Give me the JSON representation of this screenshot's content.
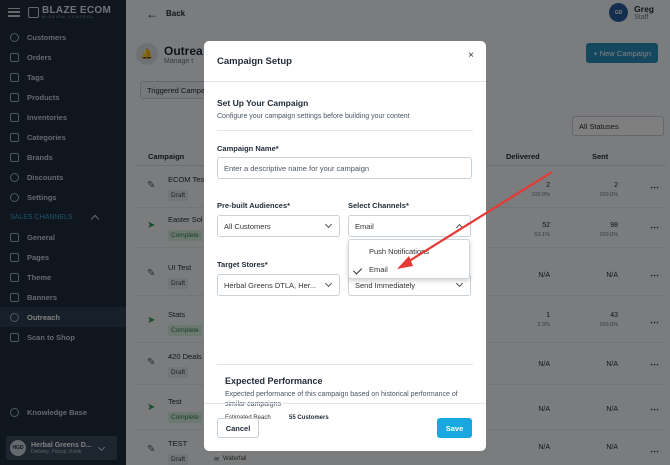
{
  "brand": {
    "name": "BLAZE ECOM",
    "tagline": "MISSION CONTROL"
  },
  "sidebar": {
    "items": [
      {
        "label": "Customers",
        "icon": "users-icon"
      },
      {
        "label": "Orders",
        "icon": "cart-icon"
      },
      {
        "label": "Tags",
        "icon": "tag-icon"
      },
      {
        "label": "Products",
        "icon": "box-icon"
      },
      {
        "label": "Inventories",
        "icon": "clipboard-icon"
      },
      {
        "label": "Categories",
        "icon": "grid-icon"
      },
      {
        "label": "Brands",
        "icon": "book-icon"
      },
      {
        "label": "Discounts",
        "icon": "percent-icon"
      },
      {
        "label": "Settings",
        "icon": "gear-icon"
      }
    ],
    "section_label": "SALES CHANNELS",
    "channel_items": [
      {
        "label": "General",
        "icon": "home-icon"
      },
      {
        "label": "Pages",
        "icon": "pages-icon"
      },
      {
        "label": "Theme",
        "icon": "palette-icon"
      },
      {
        "label": "Banners",
        "icon": "banner-icon"
      },
      {
        "label": "Outreach",
        "icon": "bell-icon",
        "active": true
      },
      {
        "label": "Scan to Shop",
        "icon": "qr-icon"
      }
    ],
    "knowledge_base": "Knowledge Base",
    "store": {
      "initials": "HGD",
      "name": "Herbal Greens D...",
      "sub": "Delivery, Pickup, Kiosk"
    }
  },
  "topbar": {
    "back_label": "Back",
    "user_initials": "GD",
    "user_name": "Greg",
    "user_role": "Staff"
  },
  "page": {
    "title": "Outrea",
    "subtitle": "Manage t",
    "new_button": "+ New Campaign",
    "filter_tab": "Triggered Campa",
    "status_filter": "All Statuses"
  },
  "table": {
    "headers": {
      "campaign": "Campaign",
      "delivered": "Delivered",
      "sent": "Sent"
    },
    "rows": [
      {
        "name": "ECOM Tes",
        "status": "Draft",
        "type": "draft",
        "delivered": "2",
        "delivered_pct": "100.0%",
        "sent": "2",
        "sent_pct": "100.0%"
      },
      {
        "name": "Easter Sol",
        "status": "Complete",
        "type": "complete",
        "delivered": "52",
        "delivered_pct": "53.1%",
        "sent": "98",
        "sent_pct": "100.0%"
      },
      {
        "name": "UI Test",
        "status": "Draft",
        "type": "draft",
        "delivered": "N/A",
        "delivered_pct": "",
        "sent": "N/A",
        "sent_pct": ""
      },
      {
        "name": "Stats",
        "status": "Complete",
        "type": "complete",
        "delivered": "1",
        "delivered_pct": "2.3%",
        "sent": "43",
        "sent_pct": "100.0%"
      },
      {
        "name": "420 Deals",
        "status": "Draft",
        "type": "draft",
        "delivered": "N/A",
        "delivered_pct": "",
        "sent": "N/A",
        "sent_pct": ""
      },
      {
        "name": "Test",
        "status": "Complete",
        "type": "complete",
        "delivered": "N/A",
        "delivered_pct": "",
        "sent": "N/A",
        "sent_pct": ""
      },
      {
        "name": "TEST",
        "status": "Draft",
        "type": "draft",
        "delivered": "N/A",
        "delivered_pct": "",
        "sent": "N/A",
        "sent_pct": "",
        "extra": "Waterfall"
      }
    ]
  },
  "modal": {
    "title": "Campaign Setup",
    "close": "×",
    "section_title": "Set Up Your Campaign",
    "section_sub": "Configure your campaign settings before building your content",
    "campaign_name_label": "Campaign Name*",
    "campaign_name_placeholder": "Enter a descriptive name for your campaign",
    "audiences_label": "Pre-built Audiences*",
    "audiences_value": "All Customers",
    "channels_label": "Select Channels*",
    "channels_value": "Email",
    "channel_options": [
      "Push Notifications",
      "Email"
    ],
    "stores_label": "Target Stores*",
    "stores_value": "Herbal Greens DTLA, Her...",
    "schedule_value": "Send Immediately",
    "perf_title": "Expected Performance",
    "perf_desc": "Expected performance of this campaign based on historical performance of similar campaigns",
    "reach_label": "Estimated Reach",
    "reach_value": "55 Customers",
    "cancel": "Cancel",
    "save": "Save"
  },
  "colors": {
    "accent": "#1aa7e0",
    "sidebar": "#1f2d3d",
    "annotation_arrow": "#e53935"
  }
}
